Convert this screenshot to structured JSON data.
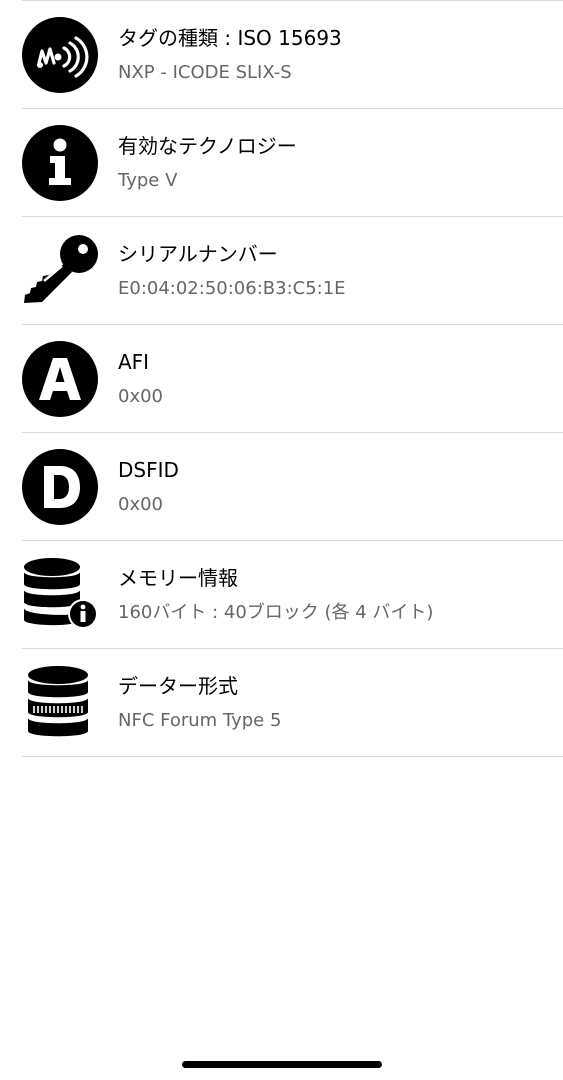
{
  "rows": [
    {
      "icon": "nfc-tag-icon",
      "title": "タグの種類 : ISO 15693",
      "subtitle": "NXP - ICODE SLIX-S"
    },
    {
      "icon": "info-icon",
      "title": "有効なテクノロジー",
      "subtitle": "Type V"
    },
    {
      "icon": "key-icon",
      "title": "シリアルナンバー",
      "subtitle": "E0:04:02:50:06:B3:C5:1E"
    },
    {
      "icon": "letter-a-icon",
      "title": "AFI",
      "subtitle": "0x00"
    },
    {
      "icon": "letter-d-icon",
      "title": "DSFID",
      "subtitle": "0x00"
    },
    {
      "icon": "database-info-icon",
      "title": "メモリー情報",
      "subtitle": "160バイト : 40ブロック (各 4 バイト)"
    },
    {
      "icon": "database-barcode-icon",
      "title": "データー形式",
      "subtitle": "NFC Forum Type 5"
    }
  ]
}
